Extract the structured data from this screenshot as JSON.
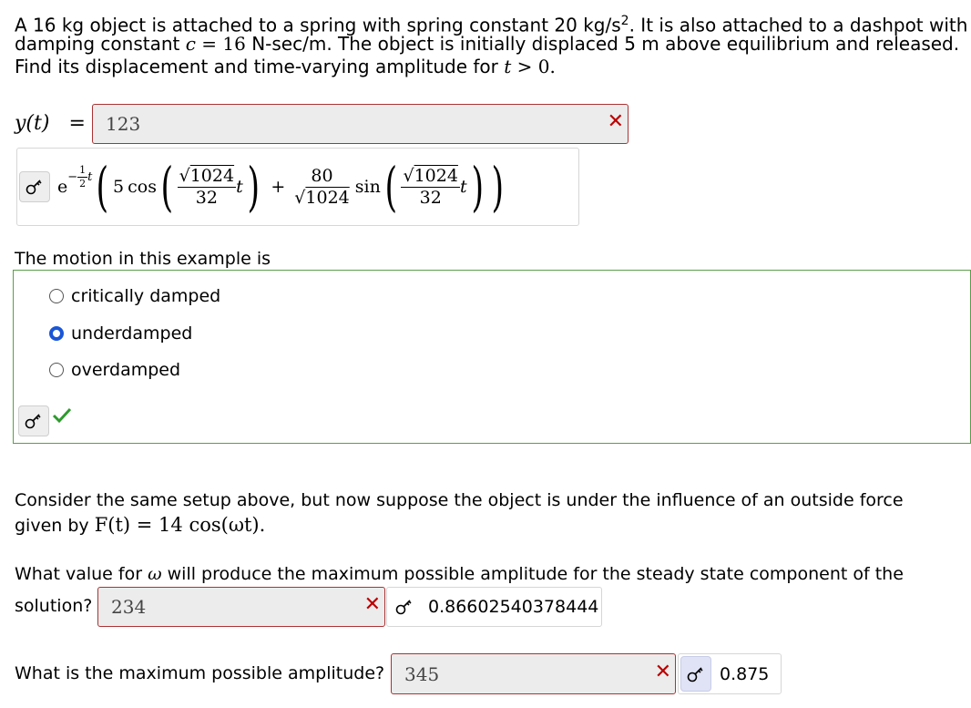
{
  "problem": {
    "line1_a": "A 16 kg object is attached to a spring with spring constant 20 kg/s",
    "line1_sup": "2",
    "line1_b": ". It is also attached to a dashpot with",
    "line2_a": "damping constant",
    "line2_var": "c",
    "line2_eq": " = 16",
    "line2_b": "N-sec/m. The object is initially displaced 5 m above equilibrium and released.",
    "line3_a": "Find its displacement and time-varying amplitude for",
    "line3_var": "t",
    "line3_b": " > 0."
  },
  "q1": {
    "label": "y(t)",
    "equals": "=",
    "input_value": "123",
    "answer": {
      "e": "e",
      "exp_sign": "−",
      "exp_num": "1",
      "exp_den": "2",
      "exp_var": "t",
      "coef": "5",
      "cos": "cos",
      "rad": "1024",
      "den": "32",
      "var": "t",
      "plus": "+",
      "num2": "80",
      "rad2": "1024",
      "sin": "sin",
      "rad3": "1024",
      "den3": "32",
      "var3": "t"
    }
  },
  "q2": {
    "prompt": "The motion in this example is",
    "options": [
      "critically damped",
      "underdamped",
      "overdamped"
    ],
    "selected": "underdamped"
  },
  "part2": {
    "line1_a": "Consider the same setup above, but now suppose the object is under the influence of an outside force",
    "line2_a": "given by",
    "line2_math": "F(t) = 14 cos(ωt).",
    "q_omega_a": "What value for",
    "q_omega_var": "ω",
    "q_omega_b": "will produce the maximum possible amplitude for the steady state component of the",
    "q_omega_c": "solution?",
    "omega_input": "234",
    "omega_answer": "0.86602540378444",
    "amp_prompt": "What is the maximum possible amplitude?",
    "amp_input": "345",
    "amp_answer": "0.875"
  },
  "colors": {
    "wrong": "#b00000",
    "correct": "#2e9a2e",
    "radio_selected": "#1a56d6",
    "panel_border": "#5a9e4a"
  },
  "icons": {
    "key": "key-icon",
    "wrong": "x-mark-icon",
    "correct": "check-mark-icon"
  }
}
